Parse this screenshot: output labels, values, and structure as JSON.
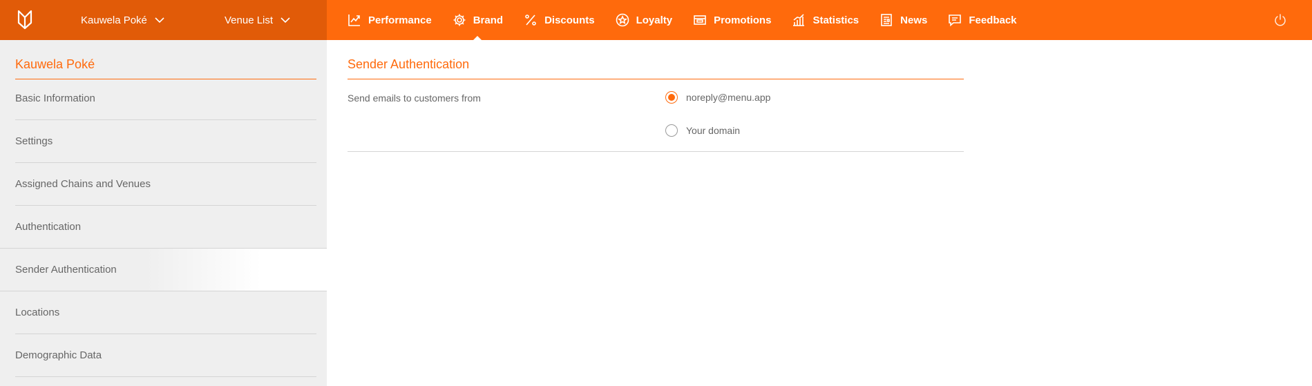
{
  "header": {
    "brand_dropdown": "Kauwela Poké",
    "venue_dropdown": "Venue List",
    "nav": [
      {
        "label": "Performance",
        "icon": "trend-chart-icon"
      },
      {
        "label": "Brand",
        "icon": "gear-icon",
        "active": true
      },
      {
        "label": "Discounts",
        "icon": "percent-icon"
      },
      {
        "label": "Loyalty",
        "icon": "star-badge-icon"
      },
      {
        "label": "Promotions",
        "icon": "promo-ticket-icon"
      },
      {
        "label": "Statistics",
        "icon": "bar-chart-icon"
      },
      {
        "label": "News",
        "icon": "newspaper-icon"
      },
      {
        "label": "Feedback",
        "icon": "chat-icon"
      }
    ],
    "accent_color": "#ff6a0c"
  },
  "sidebar": {
    "title": "Kauwela Poké",
    "items": [
      {
        "label": "Basic Information"
      },
      {
        "label": "Settings"
      },
      {
        "label": "Assigned Chains and Venues"
      },
      {
        "label": "Authentication"
      },
      {
        "label": "Sender Authentication",
        "active": true
      },
      {
        "label": "Locations"
      },
      {
        "label": "Demographic Data"
      }
    ]
  },
  "main": {
    "title": "Sender Authentication",
    "field_label": "Send emails to customers from",
    "options": [
      {
        "label": "noreply@menu.app",
        "selected": true
      },
      {
        "label": "Your domain",
        "selected": false
      }
    ]
  }
}
